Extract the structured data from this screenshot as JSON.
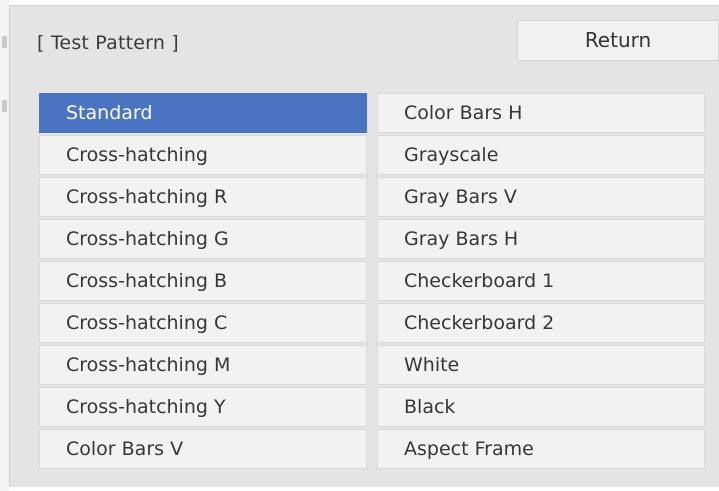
{
  "dialog": {
    "title": "[ Test Pattern ]",
    "return_label": "Return"
  },
  "patterns": {
    "left": [
      {
        "label": "Standard",
        "selected": true
      },
      {
        "label": "Cross-hatching",
        "selected": false
      },
      {
        "label": "Cross-hatching R",
        "selected": false
      },
      {
        "label": "Cross-hatching G",
        "selected": false
      },
      {
        "label": "Cross-hatching B",
        "selected": false
      },
      {
        "label": "Cross-hatching C",
        "selected": false
      },
      {
        "label": "Cross-hatching M",
        "selected": false
      },
      {
        "label": "Cross-hatching Y",
        "selected": false
      },
      {
        "label": "Color Bars V",
        "selected": false
      }
    ],
    "right": [
      {
        "label": "Color Bars H",
        "selected": false
      },
      {
        "label": "Grayscale",
        "selected": false
      },
      {
        "label": "Gray Bars V",
        "selected": false
      },
      {
        "label": "Gray Bars H",
        "selected": false
      },
      {
        "label": "Checkerboard 1",
        "selected": false
      },
      {
        "label": "Checkerboard 2",
        "selected": false
      },
      {
        "label": "White",
        "selected": false
      },
      {
        "label": "Black",
        "selected": false
      },
      {
        "label": "Aspect Frame",
        "selected": false
      }
    ]
  },
  "colors": {
    "selection": "#4a73c2",
    "panel_background": "#e4e4e4",
    "cell_background": "#f2f2f2"
  }
}
